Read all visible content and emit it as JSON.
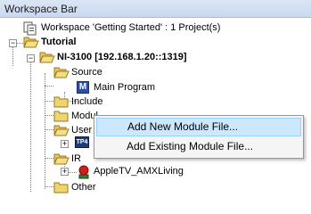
{
  "panel": {
    "title": "Workspace Bar"
  },
  "tree": {
    "workspace": "Workspace 'Getting Started' : 1 Project(s)",
    "project": "Tutorial",
    "system": "NI-3100 [192.168.1.20::1319]",
    "source": "Source",
    "main_program": "Main Program",
    "include": "Include",
    "module_partial": "Modul",
    "user_partial": "User",
    "ir": "IR",
    "ir_file": "AppleTV_AMXLiving",
    "other": "Other",
    "tp4_badge": "TP4",
    "main_program_badge": "M"
  },
  "context_menu": {
    "items": [
      {
        "label": "Add New Module File...",
        "highlighted": true
      },
      {
        "label": "Add Existing Module File...",
        "highlighted": false
      }
    ]
  }
}
